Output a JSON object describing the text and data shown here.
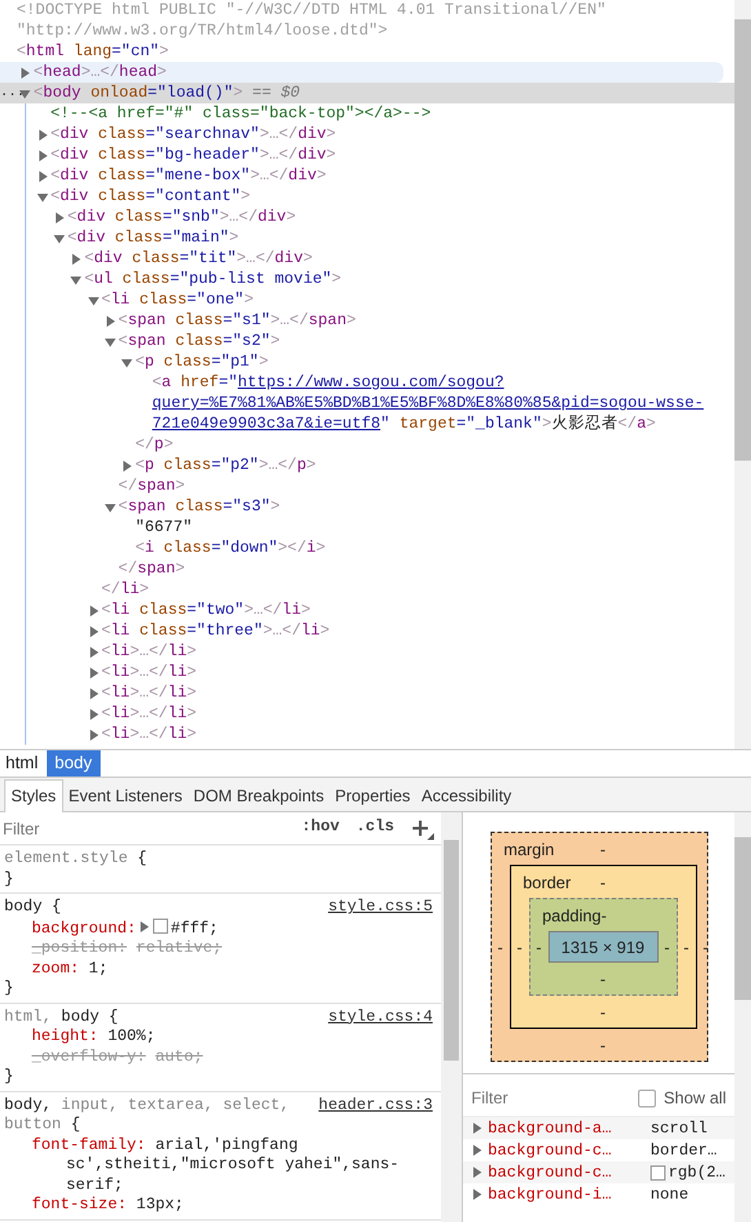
{
  "dom": {
    "nodes": [
      {
        "line": [
          {
            "kind": "doctype",
            "text": "<!DOCTYPE html PUBLIC \"-//W3C//DTD HTML 4.01 Transitional//EN\" \"http://www.w3.org/TR/html4/loose.dtd\">"
          }
        ],
        "selected": false,
        "hovered": false
      },
      {
        "line": [
          {
            "kind": "punct",
            "text": "<"
          },
          {
            "kind": "tag",
            "text": "html"
          },
          {
            "kind": "attr",
            "text": " lang"
          },
          {
            "kind": "value",
            "text": "=\"cn\""
          },
          {
            "kind": "punct",
            "text": ">"
          }
        ],
        "selected": false,
        "hovered": false,
        "children": [
          {
            "line": [
              {
                "kind": "punct",
                "text": "<"
              },
              {
                "kind": "tag",
                "text": "head"
              },
              {
                "kind": "punct",
                "text": ">…</"
              },
              {
                "kind": "tag",
                "text": "head"
              },
              {
                "kind": "punct",
                "text": ">"
              }
            ],
            "expanded": false,
            "selected": false,
            "hovered": true
          },
          {
            "dots": "...",
            "line": [
              {
                "kind": "punct",
                "text": "<"
              },
              {
                "kind": "tag",
                "text": "body"
              },
              {
                "kind": "attr",
                "text": " onload"
              },
              {
                "kind": "value",
                "text": "=\"load()\""
              },
              {
                "kind": "punct",
                "text": ">"
              },
              {
                "kind": "marker",
                "text": " == $0"
              }
            ],
            "expanded": true,
            "selected": true,
            "hovered": false,
            "children": [
              {
                "line": [
                  {
                    "kind": "comment",
                    "text": "<!--<a href=\"#\" class=\"back-top\"></a>-->"
                  }
                ],
                "selected": false,
                "hovered": false
              },
              {
                "line": [
                  {
                    "kind": "punct",
                    "text": "<"
                  },
                  {
                    "kind": "tag",
                    "text": "div"
                  },
                  {
                    "kind": "attr",
                    "text": " class"
                  },
                  {
                    "kind": "value",
                    "text": "=\"searchnav\""
                  },
                  {
                    "kind": "punct",
                    "text": ">…</"
                  },
                  {
                    "kind": "tag",
                    "text": "div"
                  },
                  {
                    "kind": "punct",
                    "text": ">"
                  }
                ],
                "expanded": false,
                "selected": false,
                "hovered": false
              },
              {
                "line": [
                  {
                    "kind": "punct",
                    "text": "<"
                  },
                  {
                    "kind": "tag",
                    "text": "div"
                  },
                  {
                    "kind": "attr",
                    "text": " class"
                  },
                  {
                    "kind": "value",
                    "text": "=\"bg-header\""
                  },
                  {
                    "kind": "punct",
                    "text": ">…</"
                  },
                  {
                    "kind": "tag",
                    "text": "div"
                  },
                  {
                    "kind": "punct",
                    "text": ">"
                  }
                ],
                "expanded": false,
                "selected": false,
                "hovered": false
              },
              {
                "line": [
                  {
                    "kind": "punct",
                    "text": "<"
                  },
                  {
                    "kind": "tag",
                    "text": "div"
                  },
                  {
                    "kind": "attr",
                    "text": " class"
                  },
                  {
                    "kind": "value",
                    "text": "=\"mene-box\""
                  },
                  {
                    "kind": "punct",
                    "text": ">…</"
                  },
                  {
                    "kind": "tag",
                    "text": "div"
                  },
                  {
                    "kind": "punct",
                    "text": ">"
                  }
                ],
                "expanded": false,
                "selected": false,
                "hovered": false
              },
              {
                "line": [
                  {
                    "kind": "punct",
                    "text": "<"
                  },
                  {
                    "kind": "tag",
                    "text": "div"
                  },
                  {
                    "kind": "attr",
                    "text": " class"
                  },
                  {
                    "kind": "value",
                    "text": "=\"contant\""
                  },
                  {
                    "kind": "punct",
                    "text": ">"
                  }
                ],
                "expanded": true,
                "selected": false,
                "hovered": false,
                "children": [
                  {
                    "line": [
                      {
                        "kind": "punct",
                        "text": "<"
                      },
                      {
                        "kind": "tag",
                        "text": "div"
                      },
                      {
                        "kind": "attr",
                        "text": " class"
                      },
                      {
                        "kind": "value",
                        "text": "=\"snb\""
                      },
                      {
                        "kind": "punct",
                        "text": ">…</"
                      },
                      {
                        "kind": "tag",
                        "text": "div"
                      },
                      {
                        "kind": "punct",
                        "text": ">"
                      }
                    ],
                    "expanded": false,
                    "selected": false,
                    "hovered": false
                  },
                  {
                    "line": [
                      {
                        "kind": "punct",
                        "text": "<"
                      },
                      {
                        "kind": "tag",
                        "text": "div"
                      },
                      {
                        "kind": "attr",
                        "text": " class"
                      },
                      {
                        "kind": "value",
                        "text": "=\"main\""
                      },
                      {
                        "kind": "punct",
                        "text": ">"
                      }
                    ],
                    "expanded": true,
                    "selected": false,
                    "hovered": false,
                    "children": [
                      {
                        "line": [
                          {
                            "kind": "punct",
                            "text": "<"
                          },
                          {
                            "kind": "tag",
                            "text": "div"
                          },
                          {
                            "kind": "attr",
                            "text": " class"
                          },
                          {
                            "kind": "value",
                            "text": "=\"tit\""
                          },
                          {
                            "kind": "punct",
                            "text": ">…</"
                          },
                          {
                            "kind": "tag",
                            "text": "div"
                          },
                          {
                            "kind": "punct",
                            "text": ">"
                          }
                        ],
                        "expanded": false,
                        "selected": false,
                        "hovered": false
                      },
                      {
                        "line": [
                          {
                            "kind": "punct",
                            "text": "<"
                          },
                          {
                            "kind": "tag",
                            "text": "ul"
                          },
                          {
                            "kind": "attr",
                            "text": " class"
                          },
                          {
                            "kind": "value",
                            "text": "=\"pub-list movie\""
                          },
                          {
                            "kind": "punct",
                            "text": ">"
                          }
                        ],
                        "expanded": true,
                        "selected": false,
                        "hovered": false,
                        "children": [
                          {
                            "line": [
                              {
                                "kind": "punct",
                                "text": "<"
                              },
                              {
                                "kind": "tag",
                                "text": "li"
                              },
                              {
                                "kind": "attr",
                                "text": " class"
                              },
                              {
                                "kind": "value",
                                "text": "=\"one\""
                              },
                              {
                                "kind": "punct",
                                "text": ">"
                              }
                            ],
                            "expanded": true,
                            "selected": false,
                            "hovered": false,
                            "end": [
                              {
                                "kind": "punct",
                                "text": "</"
                              },
                              {
                                "kind": "tag",
                                "text": "li"
                              },
                              {
                                "kind": "punct",
                                "text": ">"
                              }
                            ],
                            "children": [
                              {
                                "line": [
                                  {
                                    "kind": "punct",
                                    "text": "<"
                                  },
                                  {
                                    "kind": "tag",
                                    "text": "span"
                                  },
                                  {
                                    "kind": "attr",
                                    "text": " class"
                                  },
                                  {
                                    "kind": "value",
                                    "text": "=\"s1\""
                                  },
                                  {
                                    "kind": "punct",
                                    "text": ">…</"
                                  },
                                  {
                                    "kind": "tag",
                                    "text": "span"
                                  },
                                  {
                                    "kind": "punct",
                                    "text": ">"
                                  }
                                ],
                                "expanded": false,
                                "selected": false,
                                "hovered": false
                              },
                              {
                                "line": [
                                  {
                                    "kind": "punct",
                                    "text": "<"
                                  },
                                  {
                                    "kind": "tag",
                                    "text": "span"
                                  },
                                  {
                                    "kind": "attr",
                                    "text": " class"
                                  },
                                  {
                                    "kind": "value",
                                    "text": "=\"s2\""
                                  },
                                  {
                                    "kind": "punct",
                                    "text": ">"
                                  }
                                ],
                                "expanded": true,
                                "selected": false,
                                "hovered": false,
                                "end": [
                                  {
                                    "kind": "punct",
                                    "text": "</"
                                  },
                                  {
                                    "kind": "tag",
                                    "text": "span"
                                  },
                                  {
                                    "kind": "punct",
                                    "text": ">"
                                  }
                                ],
                                "children": [
                                  {
                                    "line": [
                                      {
                                        "kind": "punct",
                                        "text": "<"
                                      },
                                      {
                                        "kind": "tag",
                                        "text": "p"
                                      },
                                      {
                                        "kind": "attr",
                                        "text": " class"
                                      },
                                      {
                                        "kind": "value",
                                        "text": "=\"p1\""
                                      },
                                      {
                                        "kind": "punct",
                                        "text": ">"
                                      }
                                    ],
                                    "expanded": true,
                                    "selected": false,
                                    "hovered": false,
                                    "end": [
                                      {
                                        "kind": "punct",
                                        "text": "</"
                                      },
                                      {
                                        "kind": "tag",
                                        "text": "p"
                                      },
                                      {
                                        "kind": "punct",
                                        "text": ">"
                                      }
                                    ],
                                    "children": [
                                      {
                                        "line": [
                                          {
                                            "kind": "punct",
                                            "text": "<"
                                          },
                                          {
                                            "kind": "tag",
                                            "text": "a"
                                          },
                                          {
                                            "kind": "attr",
                                            "text": " href"
                                          },
                                          {
                                            "kind": "value",
                                            "text": "=\""
                                          },
                                          {
                                            "kind": "link",
                                            "text": "https://www.sogou.com/sogou?"
                                          },
                                          {
                                            "kind": "link",
                                            "text": "query=%E7%81%AB%E5%BD%B1%E5%BF%8D%E8%80%85&pid=sogou-wsse-"
                                          },
                                          {
                                            "kind": "link",
                                            "text": "721e049e9903c3a7&ie=utf8"
                                          },
                                          {
                                            "kind": "value",
                                            "text": "\""
                                          },
                                          {
                                            "kind": "attr",
                                            "text": " target"
                                          },
                                          {
                                            "kind": "value",
                                            "text": "=\"_blank\""
                                          },
                                          {
                                            "kind": "punct",
                                            "text": ">"
                                          },
                                          {
                                            "kind": "text",
                                            "text": "火影忍者"
                                          },
                                          {
                                            "kind": "punct",
                                            "text": "</"
                                          },
                                          {
                                            "kind": "tag",
                                            "text": "a"
                                          },
                                          {
                                            "kind": "punct",
                                            "text": ">"
                                          }
                                        ],
                                        "selected": false,
                                        "hovered": false
                                      }
                                    ]
                                  },
                                  {
                                    "line": [
                                      {
                                        "kind": "punct",
                                        "text": "<"
                                      },
                                      {
                                        "kind": "tag",
                                        "text": "p"
                                      },
                                      {
                                        "kind": "attr",
                                        "text": " class"
                                      },
                                      {
                                        "kind": "value",
                                        "text": "=\"p2\""
                                      },
                                      {
                                        "kind": "punct",
                                        "text": ">…</"
                                      },
                                      {
                                        "kind": "tag",
                                        "text": "p"
                                      },
                                      {
                                        "kind": "punct",
                                        "text": ">"
                                      }
                                    ],
                                    "expanded": false,
                                    "selected": false,
                                    "hovered": false
                                  }
                                ]
                              },
                              {
                                "line": [
                                  {
                                    "kind": "punct",
                                    "text": "<"
                                  },
                                  {
                                    "kind": "tag",
                                    "text": "span"
                                  },
                                  {
                                    "kind": "attr",
                                    "text": " class"
                                  },
                                  {
                                    "kind": "value",
                                    "text": "=\"s3\""
                                  },
                                  {
                                    "kind": "punct",
                                    "text": ">"
                                  }
                                ],
                                "expanded": true,
                                "selected": false,
                                "hovered": false,
                                "end": [
                                  {
                                    "kind": "punct",
                                    "text": "</"
                                  },
                                  {
                                    "kind": "tag",
                                    "text": "span"
                                  },
                                  {
                                    "kind": "punct",
                                    "text": ">"
                                  }
                                ],
                                "children": [
                                  {
                                    "line": [
                                      {
                                        "kind": "text",
                                        "text": "\"6677\""
                                      }
                                    ],
                                    "selected": false,
                                    "hovered": false
                                  },
                                  {
                                    "line": [
                                      {
                                        "kind": "punct",
                                        "text": "<"
                                      },
                                      {
                                        "kind": "tag",
                                        "text": "i"
                                      },
                                      {
                                        "kind": "attr",
                                        "text": " class"
                                      },
                                      {
                                        "kind": "value",
                                        "text": "=\"down\""
                                      },
                                      {
                                        "kind": "punct",
                                        "text": "></"
                                      },
                                      {
                                        "kind": "tag",
                                        "text": "i"
                                      },
                                      {
                                        "kind": "punct",
                                        "text": ">"
                                      }
                                    ],
                                    "selected": false,
                                    "hovered": false
                                  }
                                ]
                              }
                            ]
                          },
                          {
                            "line": [
                              {
                                "kind": "punct",
                                "text": "<"
                              },
                              {
                                "kind": "tag",
                                "text": "li"
                              },
                              {
                                "kind": "attr",
                                "text": " class"
                              },
                              {
                                "kind": "value",
                                "text": "=\"two\""
                              },
                              {
                                "kind": "punct",
                                "text": ">…</"
                              },
                              {
                                "kind": "tag",
                                "text": "li"
                              },
                              {
                                "kind": "punct",
                                "text": ">"
                              }
                            ],
                            "expanded": false,
                            "selected": false,
                            "hovered": false
                          },
                          {
                            "line": [
                              {
                                "kind": "punct",
                                "text": "<"
                              },
                              {
                                "kind": "tag",
                                "text": "li"
                              },
                              {
                                "kind": "attr",
                                "text": " class"
                              },
                              {
                                "kind": "value",
                                "text": "=\"three\""
                              },
                              {
                                "kind": "punct",
                                "text": ">…</"
                              },
                              {
                                "kind": "tag",
                                "text": "li"
                              },
                              {
                                "kind": "punct",
                                "text": ">"
                              }
                            ],
                            "expanded": false,
                            "selected": false,
                            "hovered": false
                          },
                          {
                            "line": [
                              {
                                "kind": "punct",
                                "text": "<"
                              },
                              {
                                "kind": "tag",
                                "text": "li"
                              },
                              {
                                "kind": "punct",
                                "text": ">…</"
                              },
                              {
                                "kind": "tag",
                                "text": "li"
                              },
                              {
                                "kind": "punct",
                                "text": ">"
                              }
                            ],
                            "expanded": false,
                            "selected": false,
                            "hovered": false
                          },
                          {
                            "line": [
                              {
                                "kind": "punct",
                                "text": "<"
                              },
                              {
                                "kind": "tag",
                                "text": "li"
                              },
                              {
                                "kind": "punct",
                                "text": ">…</"
                              },
                              {
                                "kind": "tag",
                                "text": "li"
                              },
                              {
                                "kind": "punct",
                                "text": ">"
                              }
                            ],
                            "expanded": false,
                            "selected": false,
                            "hovered": false
                          },
                          {
                            "line": [
                              {
                                "kind": "punct",
                                "text": "<"
                              },
                              {
                                "kind": "tag",
                                "text": "li"
                              },
                              {
                                "kind": "punct",
                                "text": ">…</"
                              },
                              {
                                "kind": "tag",
                                "text": "li"
                              },
                              {
                                "kind": "punct",
                                "text": ">"
                              }
                            ],
                            "expanded": false,
                            "selected": false,
                            "hovered": false
                          },
                          {
                            "line": [
                              {
                                "kind": "punct",
                                "text": "<"
                              },
                              {
                                "kind": "tag",
                                "text": "li"
                              },
                              {
                                "kind": "punct",
                                "text": ">…</"
                              },
                              {
                                "kind": "tag",
                                "text": "li"
                              },
                              {
                                "kind": "punct",
                                "text": ">"
                              }
                            ],
                            "expanded": false,
                            "selected": false,
                            "hovered": false
                          },
                          {
                            "line": [
                              {
                                "kind": "punct",
                                "text": "<"
                              },
                              {
                                "kind": "tag",
                                "text": "li"
                              },
                              {
                                "kind": "punct",
                                "text": ">…</"
                              },
                              {
                                "kind": "tag",
                                "text": "li"
                              },
                              {
                                "kind": "punct",
                                "text": ">"
                              }
                            ],
                            "expanded": false,
                            "selected": false,
                            "hovered": false
                          }
                        ]
                      }
                    ]
                  }
                ]
              }
            ]
          }
        ]
      }
    ]
  },
  "breadcrumbs": [
    {
      "label": "html",
      "selected": false
    },
    {
      "label": "body",
      "selected": true
    }
  ],
  "tabs": [
    {
      "label": "Styles",
      "selected": true
    },
    {
      "label": "Event Listeners",
      "selected": false
    },
    {
      "label": "DOM Breakpoints",
      "selected": false
    },
    {
      "label": "Properties",
      "selected": false
    },
    {
      "label": "Accessibility",
      "selected": false
    }
  ],
  "styles": {
    "filter": {
      "placeholder": "Filter"
    },
    "toggles": [
      ":hov",
      ".cls"
    ],
    "rules": [
      {
        "selector": [
          {
            "text": "element.style",
            "matched": false
          }
        ],
        "open": " {",
        "close": "}"
      },
      {
        "selector": [
          {
            "text": "body",
            "matched": true
          }
        ],
        "open": " {",
        "source": "style.css:5",
        "close": "}",
        "properties": [
          {
            "name": "background:",
            "value": "#fff;",
            "swatch": true,
            "struck": false
          },
          {
            "name": "_position:",
            "value": "relative;",
            "swatch": false,
            "struck": true
          },
          {
            "name": "zoom:",
            "value": "1;",
            "swatch": false,
            "struck": false
          }
        ]
      },
      {
        "selector": [
          {
            "text": "html, ",
            "matched": false
          },
          {
            "text": "body",
            "matched": true
          }
        ],
        "open": " {",
        "source": "style.css:4",
        "close": "}",
        "properties": [
          {
            "name": "height:",
            "value": "100%;",
            "swatch": false,
            "struck": false
          },
          {
            "name": "_overflow-y:",
            "value": "auto;",
            "swatch": false,
            "struck": true
          }
        ]
      },
      {
        "selector": [
          {
            "text": "body, ",
            "matched": true
          },
          {
            "text": "input, ",
            "matched": false
          },
          {
            "text": "textarea, ",
            "matched": false
          },
          {
            "text": "select, ",
            "matched": false
          },
          {
            "text": "button",
            "matched": false
          }
        ],
        "open": " {",
        "source": "header.css:3",
        "properties": [
          {
            "name": "font-family:",
            "value": "arial,'pingfang sc',stheiti,\"microsoft yahei\",sans-serif;",
            "swatch": false,
            "struck": false
          },
          {
            "name": "font-size:",
            "value": "13px;",
            "swatch": false,
            "struck": false
          }
        ]
      }
    ]
  },
  "box_model": {
    "margin": {
      "label": "margin",
      "top": "-",
      "right": "-",
      "bottom": "-",
      "left": "-"
    },
    "border": {
      "label": "border",
      "top": "-",
      "right": "-",
      "bottom": "-",
      "left": "-"
    },
    "padding": {
      "label": "padding",
      "top": "-",
      "right": "-",
      "bottom": "-",
      "left": "-"
    },
    "content": "1315 × 919"
  },
  "computed": {
    "filter": {
      "placeholder": "Filter"
    },
    "show_all": {
      "label": "Show all",
      "checked": false
    },
    "rows": [
      {
        "name": "background-a…",
        "value": "scroll",
        "swatch": false,
        "expanded": false
      },
      {
        "name": "background-c…",
        "value": "border…",
        "swatch": false,
        "expanded": false
      },
      {
        "name": "background-c…",
        "value": "rgb(2…",
        "swatch": true,
        "expanded": false
      },
      {
        "name": "background-i…",
        "value": "none",
        "swatch": false,
        "expanded": false
      }
    ]
  }
}
